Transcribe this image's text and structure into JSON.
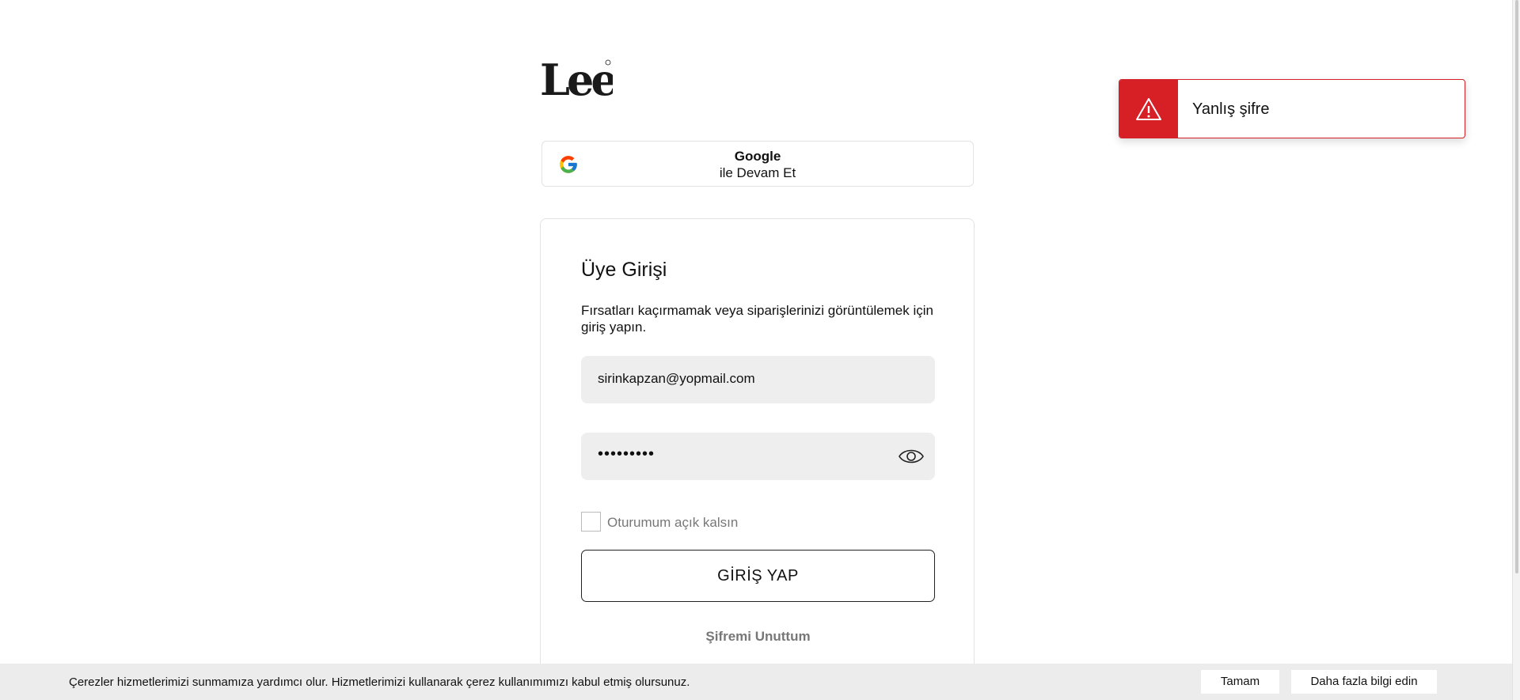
{
  "brand": {
    "logo_text": "Lee"
  },
  "google": {
    "title": "Google",
    "subtitle": "ile Devam Et",
    "icon": "google-icon"
  },
  "login": {
    "title": "Üye Girişi",
    "description": "Fırsatları kaçırmamak veya siparişlerinizi görüntülemek için giriş yapın.",
    "email_value": "sirinkapzan@yopmail.com",
    "password_masked": "•••••••••",
    "remember_label": "Oturumum açık kalsın",
    "remember_checked": false,
    "submit_label": "GİRİŞ YAP",
    "forgot_label": "Şifremi Unuttum"
  },
  "toast": {
    "message": "Yanlış şifre",
    "icon": "warning-icon",
    "accent_color": "#d71f26"
  },
  "cookie": {
    "text": "Çerezler hizmetlerimizi sunmamıza yardımcı olur. Hizmetlerimizi kullanarak çerez kullanımımızı kabul etmiş olursunuz.",
    "ok_label": "Tamam",
    "more_label": "Daha fazla bilgi edin"
  }
}
